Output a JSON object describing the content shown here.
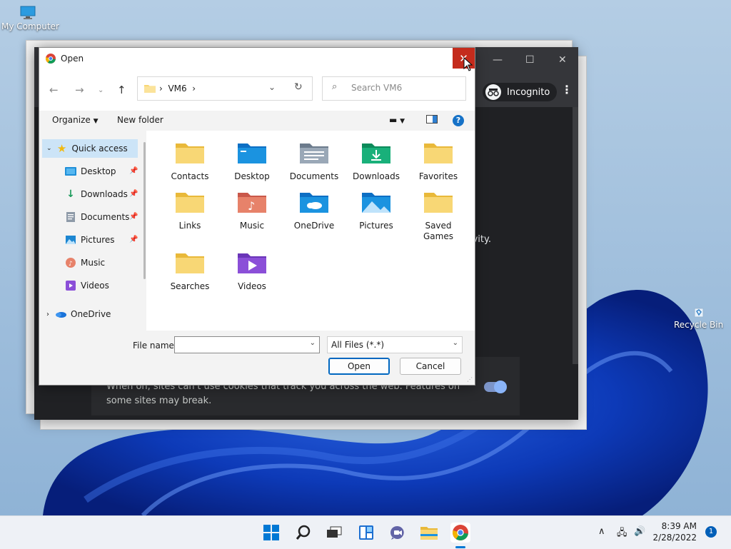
{
  "desktop": {
    "icons": [
      {
        "label": "My Computer"
      },
      {
        "label": "Recycle Bin"
      }
    ]
  },
  "chrome_window": {
    "incognito_label": "Incognito",
    "partial_text": "ivity.",
    "cookie_text": "When on, sites can't use cookies that track you across the web. Features on some sites may break."
  },
  "dialog": {
    "title": "Open",
    "address": {
      "current_folder": "VM6"
    },
    "search_placeholder": "Search VM6",
    "toolbar": {
      "organize": "Organize",
      "new_folder": "New folder",
      "help": "?"
    },
    "nav_pane": {
      "quick_access": "Quick access",
      "items": [
        {
          "label": "Desktop",
          "pinned": true
        },
        {
          "label": "Downloads",
          "pinned": true
        },
        {
          "label": "Documents",
          "pinned": true
        },
        {
          "label": "Pictures",
          "pinned": true
        },
        {
          "label": "Music",
          "pinned": false
        },
        {
          "label": "Videos",
          "pinned": false
        }
      ],
      "onedrive": "OneDrive"
    },
    "folders": [
      {
        "label": "Contacts",
        "icon": "folder-icon"
      },
      {
        "label": "Desktop",
        "icon": "desktop-folder-icon"
      },
      {
        "label": "Documents",
        "icon": "documents-folder-icon"
      },
      {
        "label": "Downloads",
        "icon": "downloads-folder-icon"
      },
      {
        "label": "Favorites",
        "icon": "folder-icon"
      },
      {
        "label": "Links",
        "icon": "folder-icon"
      },
      {
        "label": "Music",
        "icon": "music-folder-icon"
      },
      {
        "label": "OneDrive",
        "icon": "onedrive-folder-icon"
      },
      {
        "label": "Pictures",
        "icon": "pictures-folder-icon"
      },
      {
        "label": "Saved Games",
        "icon": "folder-icon"
      },
      {
        "label": "Searches",
        "icon": "folder-icon"
      },
      {
        "label": "Videos",
        "icon": "videos-folder-icon"
      }
    ],
    "file_name_label": "File name:",
    "file_name_value": "",
    "file_type": "All Files (*.*)",
    "open_button": "Open",
    "cancel_button": "Cancel"
  },
  "taskbar": {
    "time": "8:39 AM",
    "date": "2/28/2022",
    "notifications": "1"
  },
  "colors": {
    "accent": "#0067c0",
    "close_red": "#c42b1c",
    "selection": "#cce4f7",
    "folder_yellow": "#f8d775"
  }
}
